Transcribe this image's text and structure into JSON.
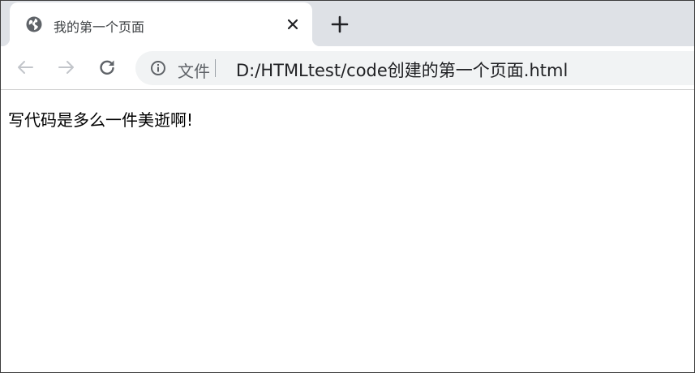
{
  "browser": {
    "tab": {
      "title": "我的第一个页面",
      "favicon": "globe-icon",
      "close_glyph": "×"
    },
    "new_tab_glyph": "+",
    "toolbar": {
      "back_icon": "arrow-left-icon",
      "forward_icon": "arrow-right-icon",
      "reload_icon": "reload-icon"
    },
    "omnibox": {
      "security_icon": "info-icon",
      "security_label": "文件",
      "url": "D:/HTMLtest/code创建的第一个页面.html"
    }
  },
  "page": {
    "body_text": "写代码是多么一件美逝啊!"
  },
  "colors": {
    "tabstrip": "#dee1e6",
    "omnibox": "#f1f3f4",
    "icon_gray": "#5f6368",
    "text_dark": "#202124"
  }
}
